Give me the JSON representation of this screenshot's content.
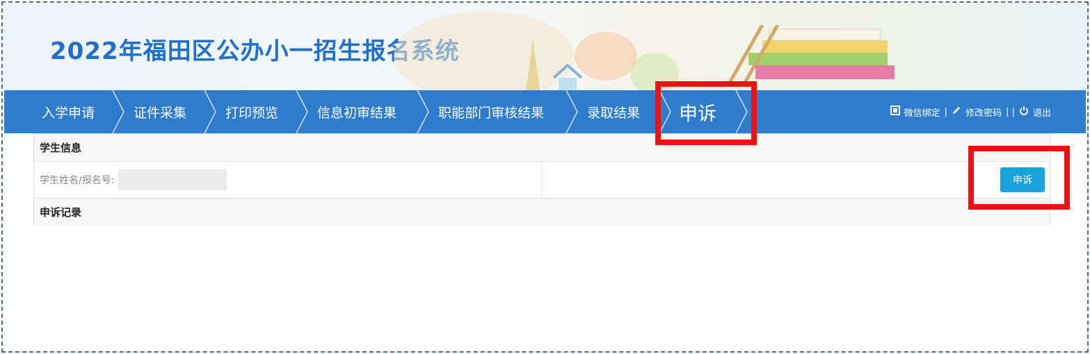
{
  "header": {
    "title": "2022年福田区公办小一招生报名系统"
  },
  "nav": {
    "steps": [
      "入学申请",
      "证件采集",
      "打印预览",
      "信息初审结果",
      "职能部门审核结果",
      "录取结果",
      "申诉"
    ],
    "active_step": "申诉",
    "links": {
      "wechat": "微信绑定",
      "password": "修改密码",
      "logout": "退出"
    }
  },
  "student_info": {
    "heading": "学生信息",
    "name_label": "学生姓名/报名号:",
    "name_value": "",
    "appeal_button": "申诉"
  },
  "appeal_records": {
    "heading": "申诉记录"
  },
  "colors": {
    "nav_bg": "#2f7ccc",
    "title": "#1d6fd0",
    "button": "#1aa2dd",
    "highlight": "#ee1111"
  },
  "icons": [
    "wechat-bind-icon",
    "edit-pencil-icon",
    "power-icon"
  ]
}
